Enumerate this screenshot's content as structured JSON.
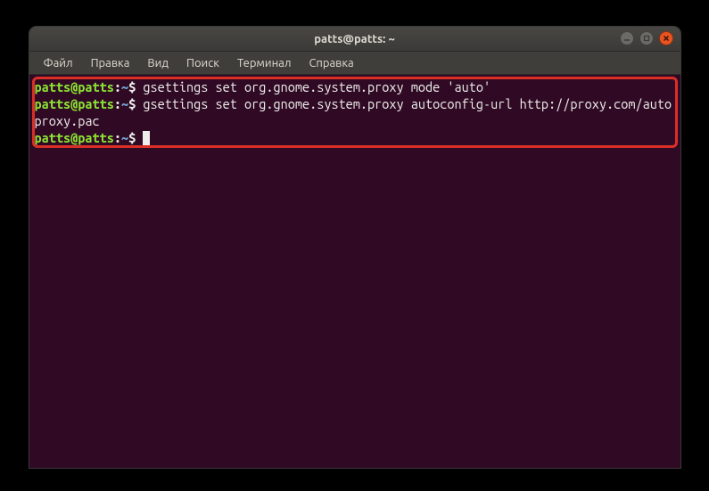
{
  "titlebar": {
    "title": "patts@patts: ~"
  },
  "menu": {
    "file": "Файл",
    "edit": "Правка",
    "view": "Вид",
    "search": "Поиск",
    "terminal": "Терминал",
    "help": "Справка"
  },
  "prompt": {
    "userhost": "patts@patts",
    "colon": ":",
    "path": "~",
    "dollar": "$"
  },
  "lines": {
    "cmd1": "gsettings set org.gnome.system.proxy mode 'auto'",
    "cmd2": "gsettings set org.gnome.system.proxy autoconfig-url http://proxy.com/autoproxy.pac"
  }
}
